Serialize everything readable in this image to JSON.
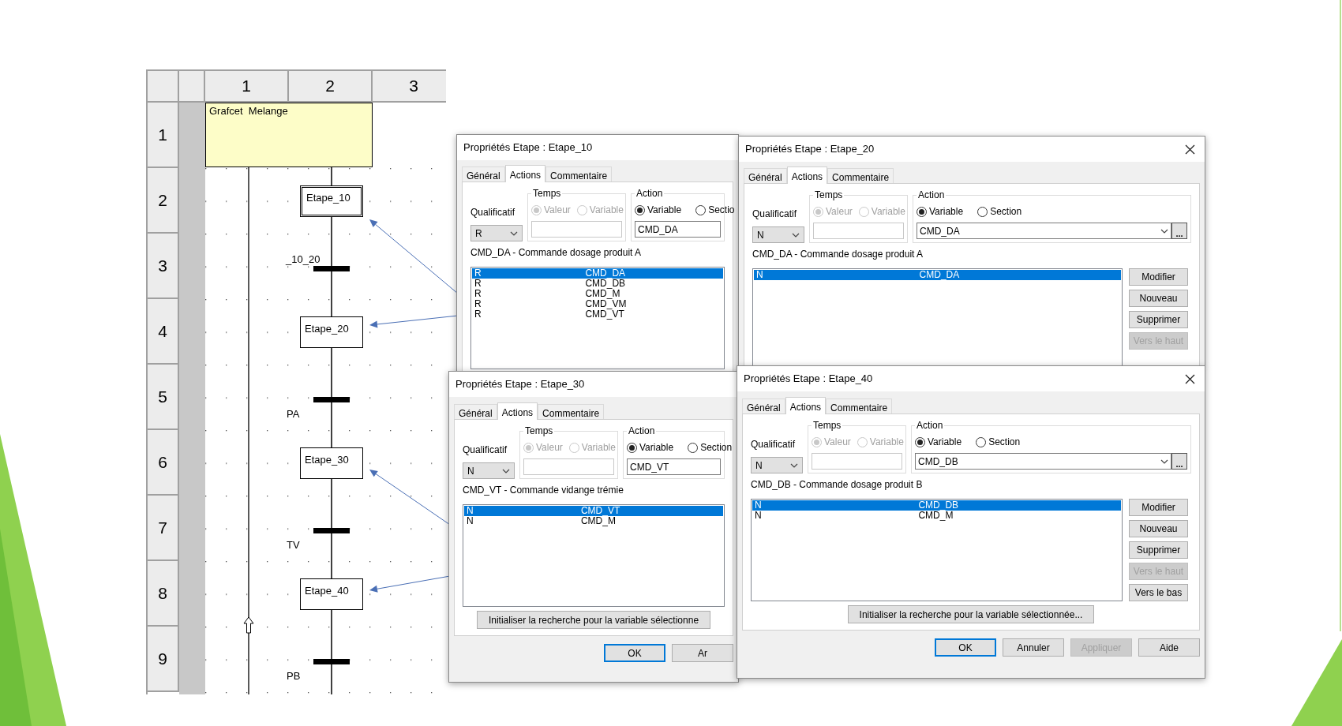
{
  "grafcet": {
    "columns": [
      "1",
      "2",
      "3"
    ],
    "rows": [
      "1",
      "2",
      "3",
      "4",
      "5",
      "6",
      "7",
      "8",
      "9"
    ],
    "title": "Grafcet  Melange",
    "steps": [
      {
        "label": "Etape_10",
        "initial": true
      },
      {
        "label": "Etape_20",
        "initial": false
      },
      {
        "label": "Etape_30",
        "initial": false
      },
      {
        "label": "Etape_40",
        "initial": false
      }
    ],
    "transitions": [
      {
        "label": "_10_20",
        "kind": "above"
      },
      {
        "label": "PA",
        "kind": "below"
      },
      {
        "label": "TV",
        "kind": "below"
      },
      {
        "label": "PB",
        "kind": "below"
      }
    ]
  },
  "dialogs": [
    {
      "title": "Propriétés Etape : Etape_10",
      "closable": false,
      "tabs": [
        {
          "label": "Général",
          "selected": false
        },
        {
          "label": "Actions",
          "selected": true
        },
        {
          "label": "Commentaire",
          "selected": false
        }
      ],
      "qualifier_label": "Qualificatif",
      "qualifier": "R",
      "time_group": "Temps",
      "time_options": [
        {
          "label": "Valeur",
          "selected": true,
          "disabled": true
        },
        {
          "label": "Variable",
          "selected": false,
          "disabled": true
        }
      ],
      "action_group": "Action",
      "action_options": [
        {
          "label": "Variable",
          "selected": true
        },
        {
          "label": "Sectio",
          "selected": false
        }
      ],
      "variable": "CMD_DA",
      "combo": false,
      "description": "CMD_DA - Commande dosage produit A",
      "actions": [
        {
          "qualifier": "R",
          "variable": "CMD_DA",
          "selected": true
        },
        {
          "qualifier": "R",
          "variable": "CMD_DB",
          "selected": false
        },
        {
          "qualifier": "R",
          "variable": "CMD_M",
          "selected": false
        },
        {
          "qualifier": "R",
          "variable": "CMD_VM",
          "selected": false
        },
        {
          "qualifier": "R",
          "variable": "CMD_VT",
          "selected": false
        }
      ]
    },
    {
      "title": "Propriétés Etape : Etape_30",
      "closable": false,
      "tabs": [
        {
          "label": "Général",
          "selected": false
        },
        {
          "label": "Actions",
          "selected": true
        },
        {
          "label": "Commentaire",
          "selected": false
        }
      ],
      "qualifier_label": "Qualificatif",
      "qualifier": "N",
      "time_group": "Temps",
      "time_options": [
        {
          "label": "Valeur",
          "selected": true,
          "disabled": true
        },
        {
          "label": "Variable",
          "selected": false,
          "disabled": true
        }
      ],
      "action_group": "Action",
      "action_options": [
        {
          "label": "Variable",
          "selected": true
        },
        {
          "label": "Section",
          "selected": false
        }
      ],
      "variable": "CMD_VT",
      "combo": false,
      "description": "CMD_VT - Commande vidange trémie",
      "actions": [
        {
          "qualifier": "N",
          "variable": "CMD_VT",
          "selected": true
        },
        {
          "qualifier": "N",
          "variable": "CMD_M",
          "selected": false
        }
      ],
      "search_button": "Initialiser la recherche pour la variable sélectionne",
      "footer_buttons": [
        {
          "label": "OK",
          "default": true,
          "disabled": false
        },
        {
          "label": "Ar",
          "default": false,
          "disabled": false
        }
      ]
    },
    {
      "title": "Propriétés Etape : Etape_20",
      "closable": true,
      "tabs": [
        {
          "label": "Général",
          "selected": false
        },
        {
          "label": "Actions",
          "selected": true
        },
        {
          "label": "Commentaire",
          "selected": false
        }
      ],
      "qualifier_label": "Qualificatif",
      "qualifier": "N",
      "time_group": "Temps",
      "time_options": [
        {
          "label": "Valeur",
          "selected": true,
          "disabled": true
        },
        {
          "label": "Variable",
          "selected": false,
          "disabled": true
        }
      ],
      "action_group": "Action",
      "action_options": [
        {
          "label": "Variable",
          "selected": true
        },
        {
          "label": "Section",
          "selected": false
        }
      ],
      "variable": "CMD_DA",
      "combo": true,
      "browse_button": "...",
      "description": "CMD_DA - Commande dosage produit A",
      "actions": [
        {
          "qualifier": "N",
          "variable": "CMD_DA",
          "selected": true
        }
      ],
      "side_buttons": [
        {
          "label": "Modifier",
          "disabled": false
        },
        {
          "label": "Nouveau",
          "disabled": false
        },
        {
          "label": "Supprimer",
          "disabled": false
        },
        {
          "label": "Vers le haut",
          "disabled": true
        }
      ]
    },
    {
      "title": "Propriétés Etape : Etape_40",
      "closable": true,
      "tabs": [
        {
          "label": "Général",
          "selected": false
        },
        {
          "label": "Actions",
          "selected": true
        },
        {
          "label": "Commentaire",
          "selected": false
        }
      ],
      "qualifier_label": "Qualificatif",
      "qualifier": "N",
      "time_group": "Temps",
      "time_options": [
        {
          "label": "Valeur",
          "selected": true,
          "disabled": true
        },
        {
          "label": "Variable",
          "selected": false,
          "disabled": true
        }
      ],
      "action_group": "Action",
      "action_options": [
        {
          "label": "Variable",
          "selected": true
        },
        {
          "label": "Section",
          "selected": false
        }
      ],
      "variable": "CMD_DB",
      "combo": true,
      "browse_button": "...",
      "description": "CMD_DB - Commande dosage produit B",
      "actions": [
        {
          "qualifier": "N",
          "variable": "CMD_DB",
          "selected": true
        },
        {
          "qualifier": "N",
          "variable": "CMD_M",
          "selected": false
        }
      ],
      "side_buttons": [
        {
          "label": "Modifier",
          "disabled": false
        },
        {
          "label": "Nouveau",
          "disabled": false
        },
        {
          "label": "Supprimer",
          "disabled": false
        },
        {
          "label": "Vers le haut",
          "disabled": true
        },
        {
          "label": "Vers le bas",
          "disabled": false
        }
      ],
      "search_button": "Initialiser la recherche pour la variable sélectionnée...",
      "footer_buttons": [
        {
          "label": "OK",
          "default": true,
          "disabled": false
        },
        {
          "label": "Annuler",
          "default": false,
          "disabled": false
        },
        {
          "label": "Appliquer",
          "default": false,
          "disabled": true
        },
        {
          "label": "Aide",
          "default": false,
          "disabled": false
        }
      ]
    }
  ]
}
